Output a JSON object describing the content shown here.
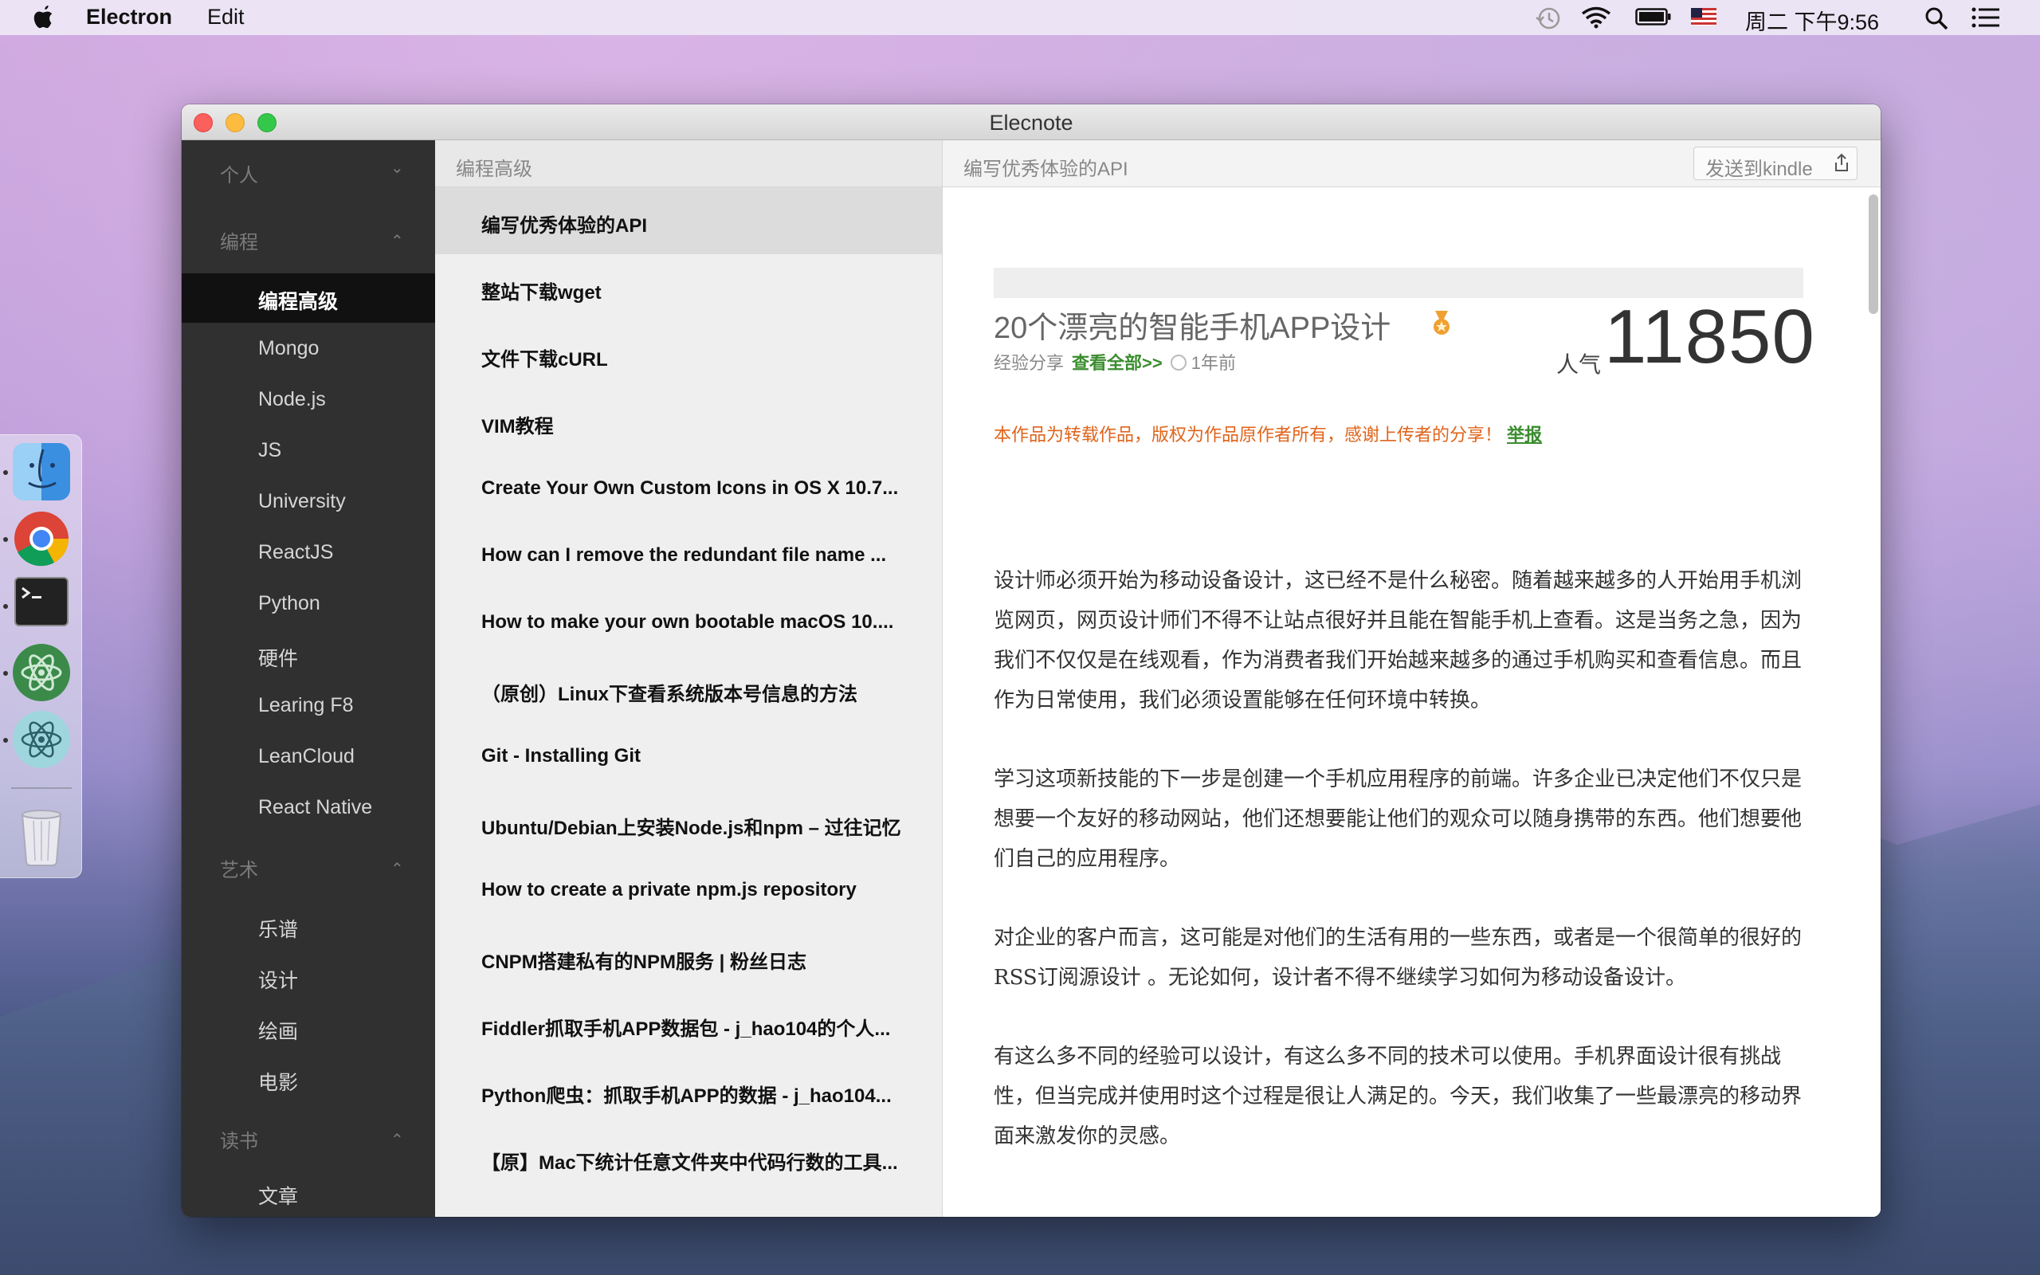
{
  "menubar": {
    "app_name": "Electron",
    "menu_edit": "Edit",
    "clock": "周二 下午9:56"
  },
  "window": {
    "title": "Elecnote"
  },
  "sidebar": {
    "groups": [
      {
        "label": "个人",
        "chevron": "⌄"
      },
      {
        "label": "编程",
        "chevron": "⌃"
      },
      {
        "label": "艺术",
        "chevron": "⌃"
      },
      {
        "label": "读书",
        "chevron": "⌃"
      }
    ],
    "items": [
      {
        "label": "编程高级"
      },
      {
        "label": "Mongo"
      },
      {
        "label": "Node.js"
      },
      {
        "label": "JS"
      },
      {
        "label": "University"
      },
      {
        "label": "ReactJS"
      },
      {
        "label": "Python"
      },
      {
        "label": "硬件"
      },
      {
        "label": "Learing F8"
      },
      {
        "label": "LeanCloud"
      },
      {
        "label": "React Native"
      },
      {
        "label": "乐谱"
      },
      {
        "label": "设计"
      },
      {
        "label": "绘画"
      },
      {
        "label": "电影"
      },
      {
        "label": "文章"
      }
    ]
  },
  "list": {
    "header": "编程高级",
    "items": [
      {
        "title": "编写优秀体验的API"
      },
      {
        "title": "整站下载wget"
      },
      {
        "title": "文件下载cURL"
      },
      {
        "title": "VIM教程"
      },
      {
        "title": "Create Your Own Custom Icons in OS X 10.7..."
      },
      {
        "title": "How can I remove the redundant file name ..."
      },
      {
        "title": "How to make your own bootable macOS 10...."
      },
      {
        "title": "（原创）Linux下查看系统版本号信息的方法"
      },
      {
        "title": "Git - Installing Git"
      },
      {
        "title": "Ubuntu/Debian上安装Node.js和npm – 过往记忆"
      },
      {
        "title": "How to create a private npm.js repository"
      },
      {
        "title": "CNPM搭建私有的NPM服务 | 粉丝日志"
      },
      {
        "title": "Fiddler抓取手机APP数据包 - j_hao104的个人..."
      },
      {
        "title": "Python爬虫：抓取手机APP的数据 - j_hao104..."
      },
      {
        "title": "【原】Mac下统计任意文件夹中代码行数的工具..."
      }
    ]
  },
  "content": {
    "header": "编写优秀体验的API",
    "kindle_button": "发送到kindle",
    "article": {
      "title": "20个漂亮的智能手机APP设计",
      "category": "经验分享",
      "view_all": "查看全部>>",
      "time": "1年前",
      "popularity_label": "人气",
      "popularity_value": "11850",
      "notice": "本作品为转载作品，版权为作品原作者所有，感谢上传者的分享！",
      "report": "举报",
      "paragraphs": [
        "设计师必须开始为移动设备设计，这已经不是什么秘密。随着越来越多的人开始用手机浏览网页，网页设计师们不得不让站点很好并且能在智能手机上查看。这是当务之急，因为我们不仅仅是在线观看，作为消费者我们开始越来越多的通过手机购买和查看信息。而且作为日常使用，我们必须设置能够在任何环境中转换。",
        "学习这项新技能的下一步是创建一个手机应用程序的前端。许多企业已决定他们不仅只是想要一个友好的移动网站，他们还想要能让他们的观众可以随身携带的东西。他们想要他们自己的应用程序。",
        "对企业的客户而言，这可能是对他们的生活有用的一些东西，或者是一个很简单的很好的RSS订阅源设计 。无论如何，设计者不得不继续学习如何为移动设备设计。",
        "有这么多不同的经验可以设计，有这么多不同的技术可以使用。手机界面设计很有挑战性，但当完成并使用时这个过程是很让人满足的。今天，我们收集了一些最漂亮的移动界面来激发你的灵感。"
      ]
    }
  },
  "colors": {
    "sidebar_bg": "#303030",
    "active_item_bg": "#111111",
    "notice_orange": "#e0641b",
    "link_green": "#3a8d2e",
    "medal_orange": "#f0a030"
  },
  "icons": {
    "menubar": [
      "apple-icon",
      "time-machine-icon",
      "wifi-icon",
      "battery-icon",
      "us-flag-icon",
      "spotlight-icon",
      "notification-center-icon"
    ],
    "dock": [
      "finder-icon",
      "chrome-icon",
      "terminal-icon",
      "atom-icon",
      "electron-icon",
      "trash-icon"
    ]
  }
}
